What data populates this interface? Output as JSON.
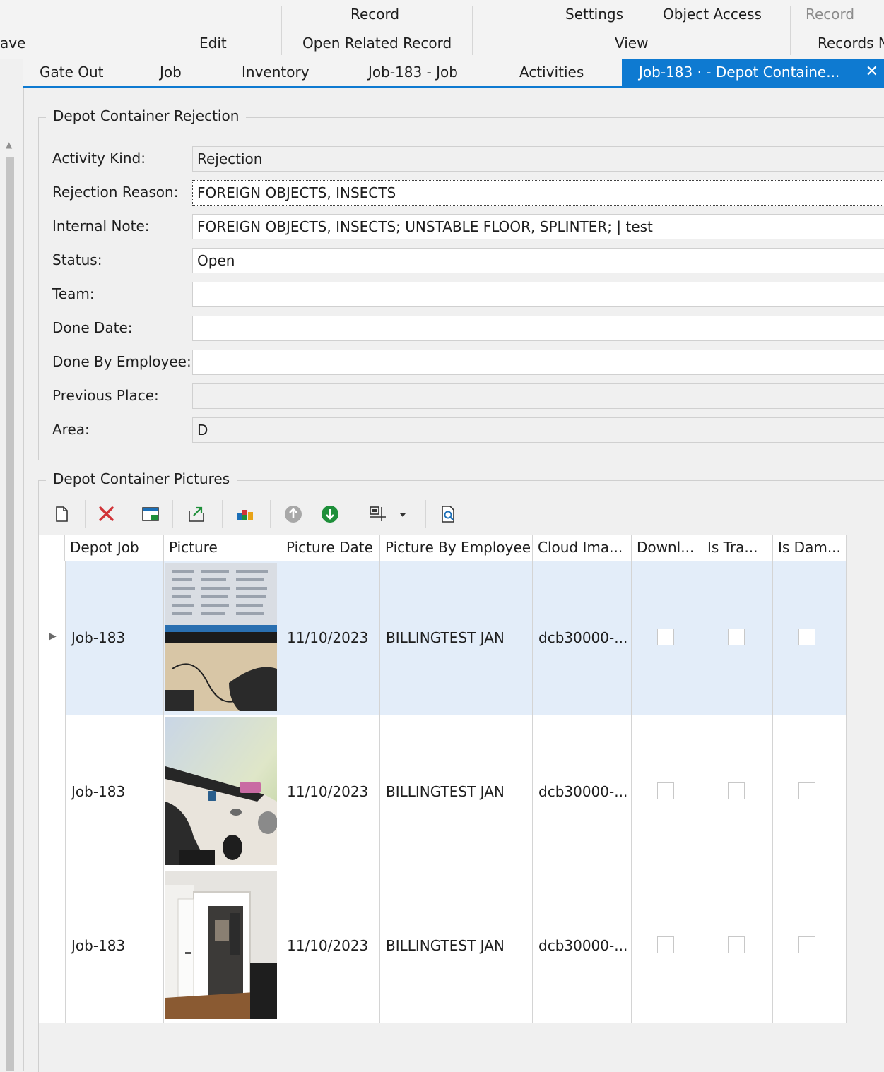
{
  "ribbon": {
    "row1": {
      "record": "Record",
      "settings": "Settings",
      "object_access": "Object Access",
      "record_right": "Record"
    },
    "row2": {
      "save_partial": "ave",
      "edit": "Edit",
      "open_related": "Open Related Record",
      "view": "View",
      "records_partial": "Records N"
    }
  },
  "tabs": [
    {
      "label": "Gate Out"
    },
    {
      "label": "Job"
    },
    {
      "label": "Inventory"
    },
    {
      "label": "Job-183 - Job"
    },
    {
      "label": "Activities"
    },
    {
      "label": "Job-183 · - Depot Containe...",
      "close": "✕"
    }
  ],
  "form": {
    "group_title": "Depot Container Rejection",
    "fields": [
      {
        "label": "Activity Kind:",
        "value": "Rejection"
      },
      {
        "label": "Rejection Reason:",
        "value": "FOREIGN OBJECTS, INSECTS"
      },
      {
        "label": "Internal Note:",
        "value": "FOREIGN OBJECTS, INSECTS; UNSTABLE FLOOR, SPLINTER;  | test"
      },
      {
        "label": "Status:",
        "value": "Open"
      },
      {
        "label": "Team:",
        "value": ""
      },
      {
        "label": "Done Date:",
        "value": ""
      },
      {
        "label": "Done By Employee:",
        "value": ""
      },
      {
        "label": "Previous Place:",
        "value": ""
      },
      {
        "label": "Area:",
        "value": "D"
      }
    ]
  },
  "pictures": {
    "group_title": "Depot Container Pictures",
    "toolbar_icons": [
      "new-icon",
      "delete-icon",
      "edit-icon",
      "export-icon",
      "chart-icon",
      "move-up-icon",
      "move-down-icon",
      "layout-icon",
      "dropdown-icon",
      "preview-icon"
    ],
    "columns": [
      "Depot Job",
      "Picture",
      "Picture Date",
      "Picture By Employee",
      "Cloud Ima...",
      "Downl...",
      "Is Tra...",
      "Is Dam..."
    ],
    "rows": [
      {
        "job": "Job-183",
        "date": "11/10/2023",
        "employee": "BILLINGTEST JAN",
        "cloud": "dcb30000-...",
        "selected": true
      },
      {
        "job": "Job-183",
        "date": "11/10/2023",
        "employee": "BILLINGTEST JAN",
        "cloud": "dcb30000-...",
        "selected": false
      },
      {
        "job": "Job-183",
        "date": "11/10/2023",
        "employee": "BILLINGTEST JAN",
        "cloud": "dcb30000-...",
        "selected": false
      }
    ]
  },
  "colors": {
    "accent": "#0e7ad1",
    "selected_row": "#e3edf9",
    "delete_red": "#d13438",
    "download_green": "#1e8f3a"
  }
}
